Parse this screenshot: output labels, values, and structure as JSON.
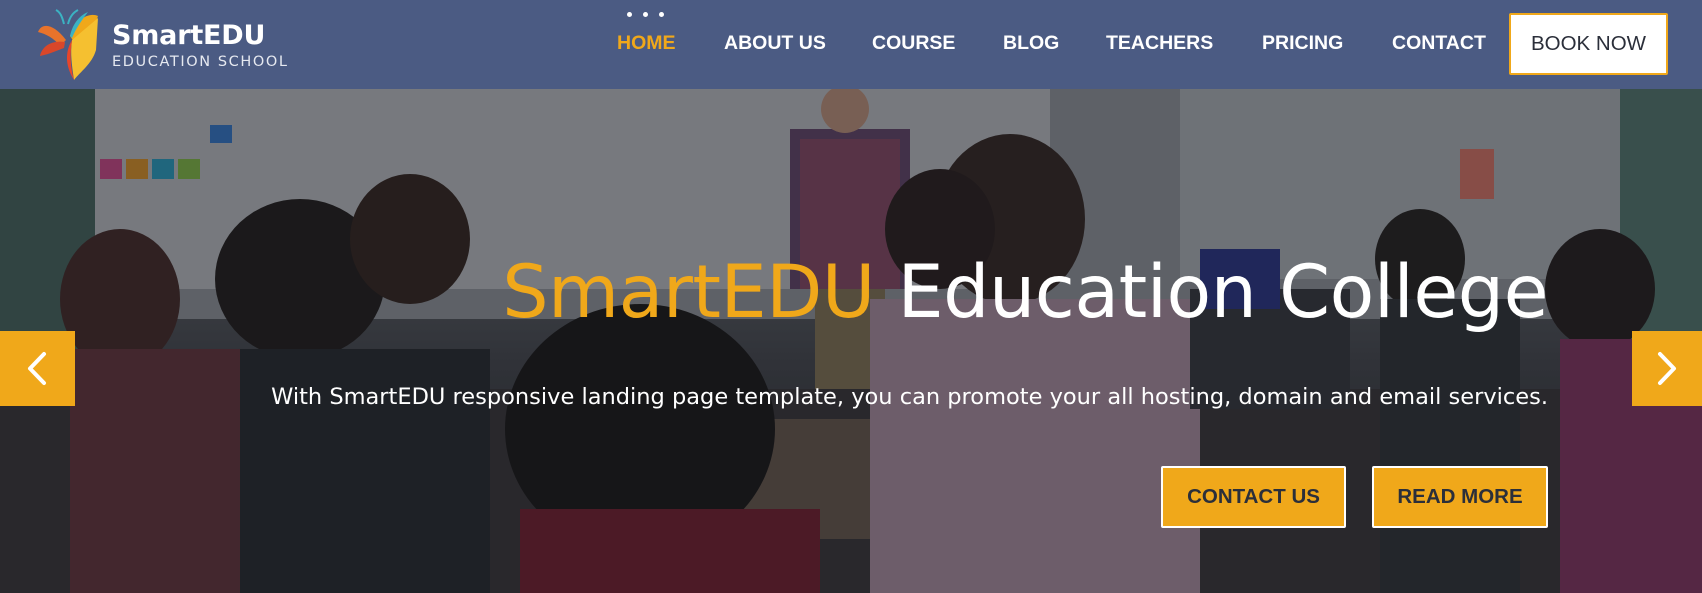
{
  "brand": {
    "name": "SmartEDU",
    "tagline": "EDUCATION SCHOOL",
    "logo_icon": "butterfly-book-logo"
  },
  "nav": {
    "items": [
      {
        "label": "HOME",
        "active": true
      },
      {
        "label": "ABOUT US",
        "active": false
      },
      {
        "label": "COURSE",
        "active": false
      },
      {
        "label": "BLOG",
        "active": false
      },
      {
        "label": "TEACHERS",
        "active": false
      },
      {
        "label": "PRICING",
        "active": false
      },
      {
        "label": "CONTACT",
        "active": false
      }
    ],
    "cta_label": "BOOK NOW"
  },
  "hero": {
    "title_brand": "SmartEDU",
    "title_rest": "Education College",
    "subtitle": "With SmartEDU responsive landing page template, you can promote your all hosting, domain and email services.",
    "primary_button": "CONTACT US",
    "secondary_button": "READ MORE",
    "prev_icon": "chevron-left-icon",
    "next_icon": "chevron-right-icon"
  },
  "colors": {
    "nav_bg": "#4b5b83",
    "accent": "#f0a81a",
    "text_dark": "#2b2f3a",
    "white": "#ffffff"
  }
}
